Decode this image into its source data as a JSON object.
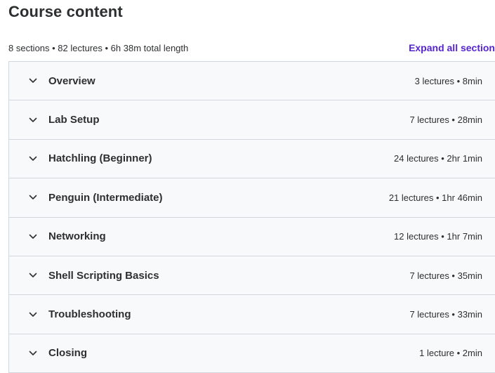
{
  "header": {
    "title": "Course content",
    "summary": "8 sections • 82 lectures • 6h 38m total length",
    "expand_all": "Expand all section"
  },
  "sections": [
    {
      "title": "Overview",
      "meta": "3 lectures • 8min"
    },
    {
      "title": "Lab Setup",
      "meta": "7 lectures • 28min"
    },
    {
      "title": "Hatchling (Beginner)",
      "meta": "24 lectures • 2hr 1min"
    },
    {
      "title": "Penguin (Intermediate)",
      "meta": "21 lectures • 1hr 46min"
    },
    {
      "title": "Networking",
      "meta": "12 lectures • 1hr 7min"
    },
    {
      "title": "Shell Scripting Basics",
      "meta": "7 lectures • 35min"
    },
    {
      "title": "Troubleshooting",
      "meta": "7 lectures • 33min"
    },
    {
      "title": "Closing",
      "meta": "1 lecture • 2min"
    }
  ],
  "icons": {
    "section_toggle": "chevron-down-icon"
  },
  "colors": {
    "accent": "#5624d0",
    "section_bg": "#f7f9fa",
    "border": "#d1d7dc",
    "text": "#2d2f31"
  }
}
